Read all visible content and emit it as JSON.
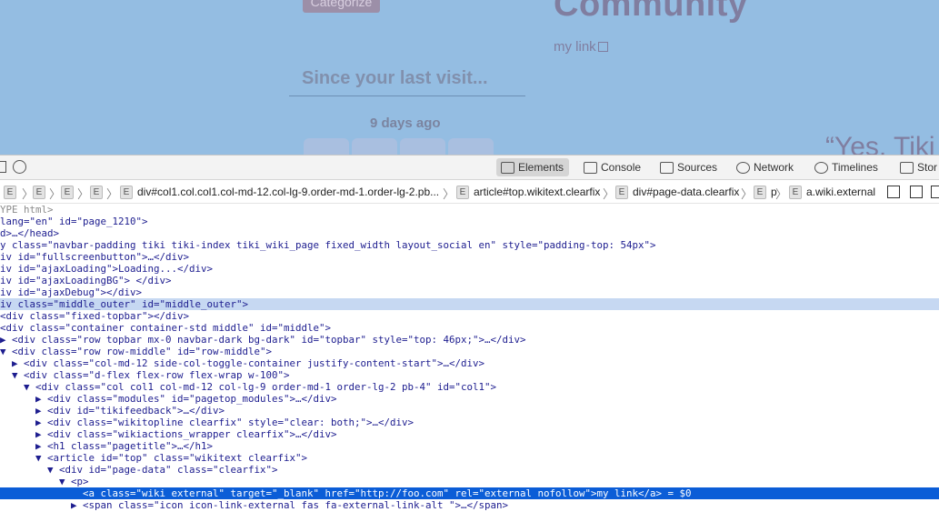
{
  "page": {
    "categorize_label": "Categorize",
    "community_title": "Community",
    "my_link": "my link",
    "since_placeholder": "Since your last visit...",
    "days_ago": "9 days ago",
    "quote": "“Yes, Tiki"
  },
  "toolbar": {
    "tabs": [
      {
        "label": "Elements",
        "icon": "elements-icon",
        "active": true
      },
      {
        "label": "Console",
        "icon": "console-icon"
      },
      {
        "label": "Sources",
        "icon": "sources-icon"
      },
      {
        "label": "Network",
        "icon": "network-icon"
      },
      {
        "label": "Timelines",
        "icon": "timelines-icon"
      },
      {
        "label": "Stor",
        "icon": "storage-icon"
      }
    ]
  },
  "breadcrumb": {
    "badge": "E",
    "long_crumb": "div#col1.col.col1.col-md-12.col-lg-9.order-md-1.order-lg-2.pb...",
    "article": "article#top.wikitext.clearfix",
    "page_data": "div#page-data.clearfix",
    "p": "p",
    "a": "a.wiki.external"
  },
  "dom": [
    {
      "text": "YPE html>",
      "color": "#8a8a8a"
    },
    {
      "text": "lang=\"en\" id=\"page_1210\">"
    },
    {
      "text": "d>…</head>"
    },
    {
      "text": "y class=\"navbar-padding tiki tiki-index tiki_wiki_page fixed_width layout_social en\" style=\"padding-top: 54px\">"
    },
    {
      "text": "iv id=\"fullscreenbutton\">…</div>"
    },
    {
      "text": "iv id=\"ajaxLoading\">Loading...</div>"
    },
    {
      "text": "iv id=\"ajaxLoadingBG\"> </div>"
    },
    {
      "text": "iv id=\"ajaxDebug\"></div>"
    },
    {
      "text": "iv class=\"middle_outer\" id=\"middle_outer\">",
      "hl": "light"
    },
    {
      "text": "<div class=\"fixed-topbar\"></div>"
    },
    {
      "text": "<div class=\"container container-std middle\" id=\"middle\">"
    },
    {
      "text": "▶ <div class=\"row topbar mx-0 navbar-dark bg-dark\" id=\"topbar\" style=\"top: 46px;\">…</div>"
    },
    {
      "text": "▼ <div class=\"row row-middle\" id=\"row-middle\">"
    },
    {
      "text": "  ▶ <div class=\"col-md-12 side-col-toggle-container justify-content-start\">…</div>"
    },
    {
      "text": "  ▼ <div class=\"d-flex flex-row flex-wrap w-100\">"
    },
    {
      "text": "    ▼ <div class=\"col col1 col-md-12 col-lg-9 order-md-1 order-lg-2 pb-4\" id=\"col1\">"
    },
    {
      "text": "      ▶ <div class=\"modules\" id=\"pagetop_modules\">…</div>"
    },
    {
      "text": "      ▶ <div id=\"tikifeedback\">…</div>"
    },
    {
      "text": "      ▶ <div class=\"wikitopline clearfix\" style=\"clear: both;\">…</div>"
    },
    {
      "text": "      ▶ <div class=\"wikiactions_wrapper clearfix\">…</div>"
    },
    {
      "text": "      ▶ <h1 class=\"pagetitle\">…</h1>"
    },
    {
      "text": "      ▼ <article id=\"top\" class=\"wikitext clearfix\">"
    },
    {
      "text": "        ▼ <div id=\"page-data\" class=\"clearfix\">"
    },
    {
      "text": "          ▼ <p>"
    },
    {
      "text": "              <a class=\"wiki external\" target=\"_blank\" href=\"http://foo.com\" rel=\"external nofollow\">my link</a> = $0",
      "hl": "dark"
    },
    {
      "text": "            ▶ <span class=\"icon icon-link-external fas fa-external-link-alt \">…</span>"
    }
  ]
}
